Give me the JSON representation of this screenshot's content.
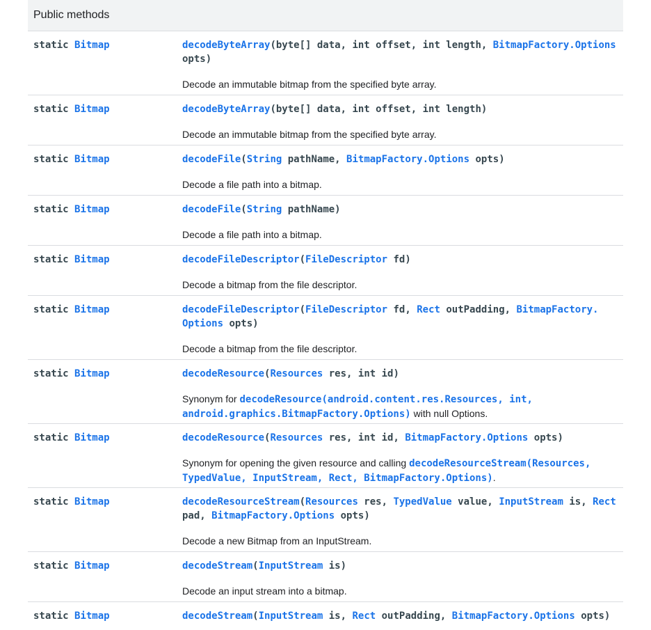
{
  "section": {
    "title": "Public methods"
  },
  "common": {
    "static": "static",
    "return_type": "Bitmap"
  },
  "rows": [
    {
      "name": "decodeByteArray",
      "params": [
        {
          "text": "(byte[] data, int offset, int length, ",
          "link": false
        },
        {
          "text": "BitmapFactory.Options",
          "link": true
        },
        {
          "text": "\nopts)",
          "link": false
        }
      ],
      "desc": "Decode an immutable bitmap from the specified byte array."
    },
    {
      "name": "decodeByteArray",
      "params": [
        {
          "text": "(byte[] data, int offset, int length)",
          "link": false
        }
      ],
      "desc": "Decode an immutable bitmap from the specified byte array."
    },
    {
      "name": "decodeFile",
      "params": [
        {
          "text": "(",
          "link": false
        },
        {
          "text": "String",
          "link": true
        },
        {
          "text": " pathName, ",
          "link": false
        },
        {
          "text": "BitmapFactory.Options",
          "link": true
        },
        {
          "text": " opts)",
          "link": false
        }
      ],
      "desc": "Decode a file path into a bitmap."
    },
    {
      "name": "decodeFile",
      "params": [
        {
          "text": "(",
          "link": false
        },
        {
          "text": "String",
          "link": true
        },
        {
          "text": " pathName)",
          "link": false
        }
      ],
      "desc": "Decode a file path into a bitmap."
    },
    {
      "name": "decodeFileDescriptor",
      "params": [
        {
          "text": "(",
          "link": false
        },
        {
          "text": "FileDescriptor",
          "link": true
        },
        {
          "text": " fd)",
          "link": false
        }
      ],
      "desc": "Decode a bitmap from the file descriptor."
    },
    {
      "name": "decodeFileDescriptor",
      "params": [
        {
          "text": "(",
          "link": false
        },
        {
          "text": "FileDescriptor",
          "link": true
        },
        {
          "text": " fd, ",
          "link": false
        },
        {
          "text": "Rect",
          "link": true
        },
        {
          "text": " outPadding, ",
          "link": false
        },
        {
          "text": "BitmapFactory.\nOptions",
          "link": true
        },
        {
          "text": " opts)",
          "link": false
        }
      ],
      "desc": "Decode a bitmap from the file descriptor."
    },
    {
      "name": "decodeResource",
      "params": [
        {
          "text": "(",
          "link": false
        },
        {
          "text": "Resources",
          "link": true
        },
        {
          "text": " res, int id)",
          "link": false
        }
      ],
      "desc_parts": [
        {
          "text": "Synonym for ",
          "link": false
        },
        {
          "text": "decodeResource(android.content.res.Resources, int,\nandroid.graphics.BitmapFactory.Options)",
          "link": true
        },
        {
          "text": " with null Options.",
          "link": false
        }
      ]
    },
    {
      "name": "decodeResource",
      "params": [
        {
          "text": "(",
          "link": false
        },
        {
          "text": "Resources",
          "link": true
        },
        {
          "text": " res, int id, ",
          "link": false
        },
        {
          "text": "BitmapFactory.Options",
          "link": true
        },
        {
          "text": " opts)",
          "link": false
        }
      ],
      "desc_parts": [
        {
          "text": "Synonym for opening the given resource and calling ",
          "link": false
        },
        {
          "text": "decodeResourceStream(Resources,\nTypedValue, InputStream, Rect, BitmapFactory.Options)",
          "link": true
        },
        {
          "text": ".",
          "link": false
        }
      ]
    },
    {
      "name": "decodeResourceStream",
      "params": [
        {
          "text": "(",
          "link": false
        },
        {
          "text": "Resources",
          "link": true
        },
        {
          "text": " res, ",
          "link": false
        },
        {
          "text": "TypedValue",
          "link": true
        },
        {
          "text": " value, ",
          "link": false
        },
        {
          "text": "InputStream",
          "link": true
        },
        {
          "text": " is, ",
          "link": false
        },
        {
          "text": "Rect",
          "link": true
        },
        {
          "text": "\npad, ",
          "link": false
        },
        {
          "text": "BitmapFactory.Options",
          "link": true
        },
        {
          "text": " opts)",
          "link": false
        }
      ],
      "desc": "Decode a new Bitmap from an InputStream."
    },
    {
      "name": "decodeStream",
      "params": [
        {
          "text": "(",
          "link": false
        },
        {
          "text": "InputStream",
          "link": true
        },
        {
          "text": " is)",
          "link": false
        }
      ],
      "desc": "Decode an input stream into a bitmap."
    },
    {
      "name": "decodeStream",
      "params": [
        {
          "text": "(",
          "link": false
        },
        {
          "text": "InputStream",
          "link": true
        },
        {
          "text": " is, ",
          "link": false
        },
        {
          "text": "Rect",
          "link": true
        },
        {
          "text": " outPadding, ",
          "link": false
        },
        {
          "text": "BitmapFactory.Options",
          "link": true
        },
        {
          "text": " opts)",
          "link": false
        }
      ],
      "desc": ""
    }
  ],
  "colors": {
    "link": "#1a73e8",
    "code_text": "#37474f",
    "header_bg": "#f1f3f4",
    "divider": "#dadce0"
  }
}
